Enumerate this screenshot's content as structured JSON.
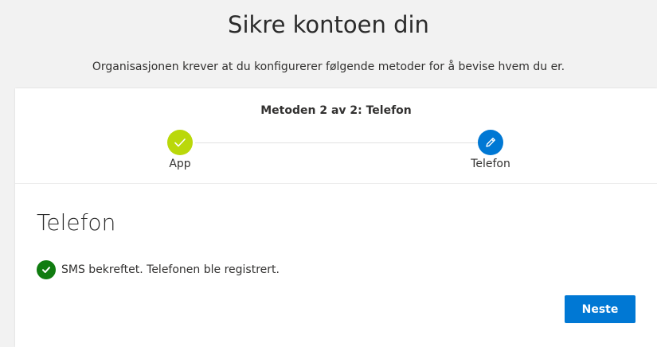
{
  "page": {
    "title": "Sikre kontoen din",
    "subtitle": "Organisasjonen krever at du konfigurerer følgende metoder for å bevise hvem du er."
  },
  "wizard": {
    "step_title": "Metoden 2 av 2: Telefon",
    "steps": [
      {
        "label": "App",
        "state": "completed",
        "icon": "checkmark-icon",
        "color": "#bad80a"
      },
      {
        "label": "Telefon",
        "state": "current",
        "icon": "pencil-icon",
        "color": "#0078d4"
      }
    ]
  },
  "section": {
    "heading": "Telefon",
    "status_icon": "success-check-icon",
    "status_color": "#107c10",
    "status_message": "SMS bekreftet. Telefonen ble registrert."
  },
  "actions": {
    "next_label": "Neste",
    "next_color": "#0078d4"
  }
}
